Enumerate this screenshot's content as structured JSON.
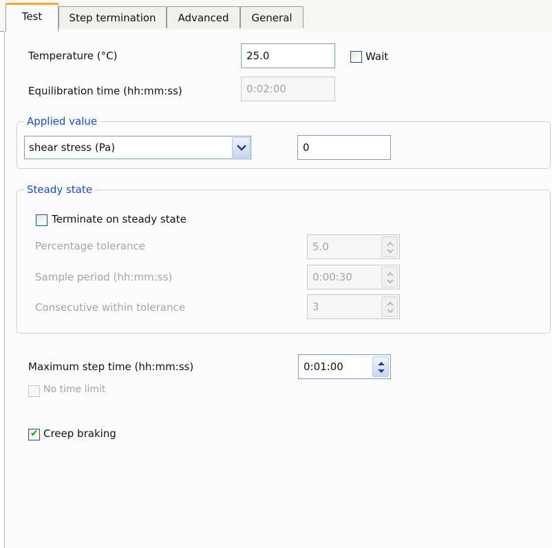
{
  "tabs": [
    {
      "label": "Test"
    },
    {
      "label": "Step termination"
    },
    {
      "label": "Advanced"
    },
    {
      "label": "General"
    }
  ],
  "temperature": {
    "label": "Temperature (°C)",
    "value": "25.0",
    "wait_label": "Wait",
    "wait_checked": false
  },
  "equilibration": {
    "label": "Equilibration time (hh:mm:ss)",
    "value": "0:02:00"
  },
  "applied_value": {
    "legend": "Applied value",
    "selected": "shear stress (Pa)",
    "value": "0"
  },
  "steady_state": {
    "legend": "Steady state",
    "terminate_label": "Terminate on steady state",
    "terminate_checked": false,
    "percentage_tolerance": {
      "label": "Percentage tolerance",
      "value": "5.0"
    },
    "sample_period": {
      "label": "Sample period (hh:mm:ss)",
      "value": "0:00:30"
    },
    "consecutive": {
      "label": "Consecutive within tolerance",
      "value": "3"
    }
  },
  "max_step_time": {
    "label": "Maximum step time (hh:mm:ss)",
    "value": "0:01:00"
  },
  "no_time_limit": {
    "label": "No time limit",
    "checked": false
  },
  "creep_braking": {
    "label": "Creep braking",
    "checked": true
  },
  "colors": {
    "accent_tab": "#f4a72c",
    "legend_blue": "#1a4bd8",
    "check_green": "#21a121"
  }
}
